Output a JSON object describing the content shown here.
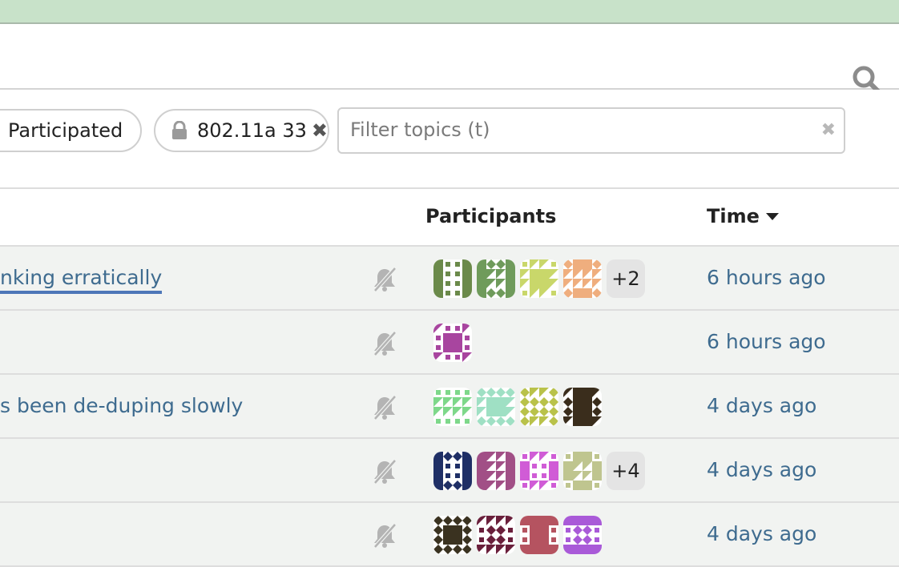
{
  "header": {
    "search_icon": "magnifier-icon"
  },
  "filters": {
    "participated_label": "Participated",
    "category_label": "802.11a 33",
    "category_lock_icon": "lock-icon",
    "category_remove_icon": "close-icon",
    "topic_filter_placeholder": "Filter topics (t)",
    "topic_filter_value": ""
  },
  "table": {
    "columns": {
      "participants": "Participants",
      "time": "Time"
    },
    "sort": {
      "column": "time",
      "direction": "descending"
    },
    "rows": [
      {
        "title": "nking erratically",
        "muted_icon": "bell-slash-icon",
        "more_participants": "+2",
        "time": "6 hours ago",
        "avatars": [
          {
            "name": "avatar-1",
            "color": "#6b8a4a",
            "bg": "#ffffff"
          },
          {
            "name": "avatar-2",
            "color": "#6f9b5b",
            "bg": "#ffffff"
          },
          {
            "name": "avatar-3",
            "color": "#c9d76a",
            "bg": "#ffffff"
          },
          {
            "name": "avatar-4",
            "color": "#efae7e",
            "bg": "#ffffff"
          }
        ]
      },
      {
        "title": "",
        "muted_icon": "bell-slash-icon",
        "more_participants": "",
        "time": "6 hours ago",
        "avatars": [
          {
            "name": "avatar-1",
            "color": "#a8459f",
            "bg": "#ffffff"
          }
        ]
      },
      {
        "title": "s been de-duping slowly",
        "muted_icon": "bell-slash-icon",
        "more_participants": "",
        "time": "4 days ago",
        "avatars": [
          {
            "name": "avatar-1",
            "color": "#7ed88a",
            "bg": "#ffffff"
          },
          {
            "name": "avatar-2",
            "color": "#9fe0c4",
            "bg": "#ffffff"
          },
          {
            "name": "avatar-3",
            "color": "#b9c24a",
            "bg": "#ffffff"
          },
          {
            "name": "avatar-4",
            "color": "#3a2d1c",
            "bg": "#ffffff"
          }
        ]
      },
      {
        "title": "",
        "muted_icon": "bell-slash-icon",
        "more_participants": "+4",
        "time": "4 days ago",
        "avatars": [
          {
            "name": "avatar-1",
            "color": "#1f2f66",
            "bg": "#ffffff"
          },
          {
            "name": "avatar-2",
            "color": "#a14f86",
            "bg": "#ffffff"
          },
          {
            "name": "avatar-3",
            "color": "#d05cd6",
            "bg": "#ffffff"
          },
          {
            "name": "avatar-4",
            "color": "#bfc58f",
            "bg": "#ffffff"
          }
        ]
      },
      {
        "title": "",
        "muted_icon": "bell-slash-icon",
        "more_participants": "",
        "time": "4 days ago",
        "avatars": [
          {
            "name": "avatar-1",
            "color": "#3a3220",
            "bg": "#ffffff"
          },
          {
            "name": "avatar-2",
            "color": "#6a1f3b",
            "bg": "#ffffff"
          },
          {
            "name": "avatar-3",
            "color": "#b55360",
            "bg": "#ffffff"
          },
          {
            "name": "avatar-4",
            "color": "#a95ad8",
            "bg": "#ffffff"
          }
        ]
      }
    ]
  },
  "colors": {
    "topbar": "#c8e2c9",
    "link": "#3e6b8f",
    "active_underline": "#4d76b8",
    "row_bg": "#f1f3f1"
  }
}
